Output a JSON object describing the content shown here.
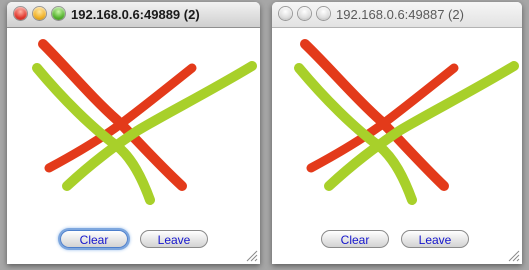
{
  "colors": {
    "red": "#e33a1a",
    "green": "#a8d02a"
  },
  "windows": [
    {
      "title": "192.168.0.6:49889 (2)",
      "active": true,
      "clear_label": "Clear",
      "leave_label": "Leave"
    },
    {
      "title": "192.168.0.6:49887 (2)",
      "active": false,
      "clear_label": "Clear",
      "leave_label": "Leave"
    }
  ]
}
